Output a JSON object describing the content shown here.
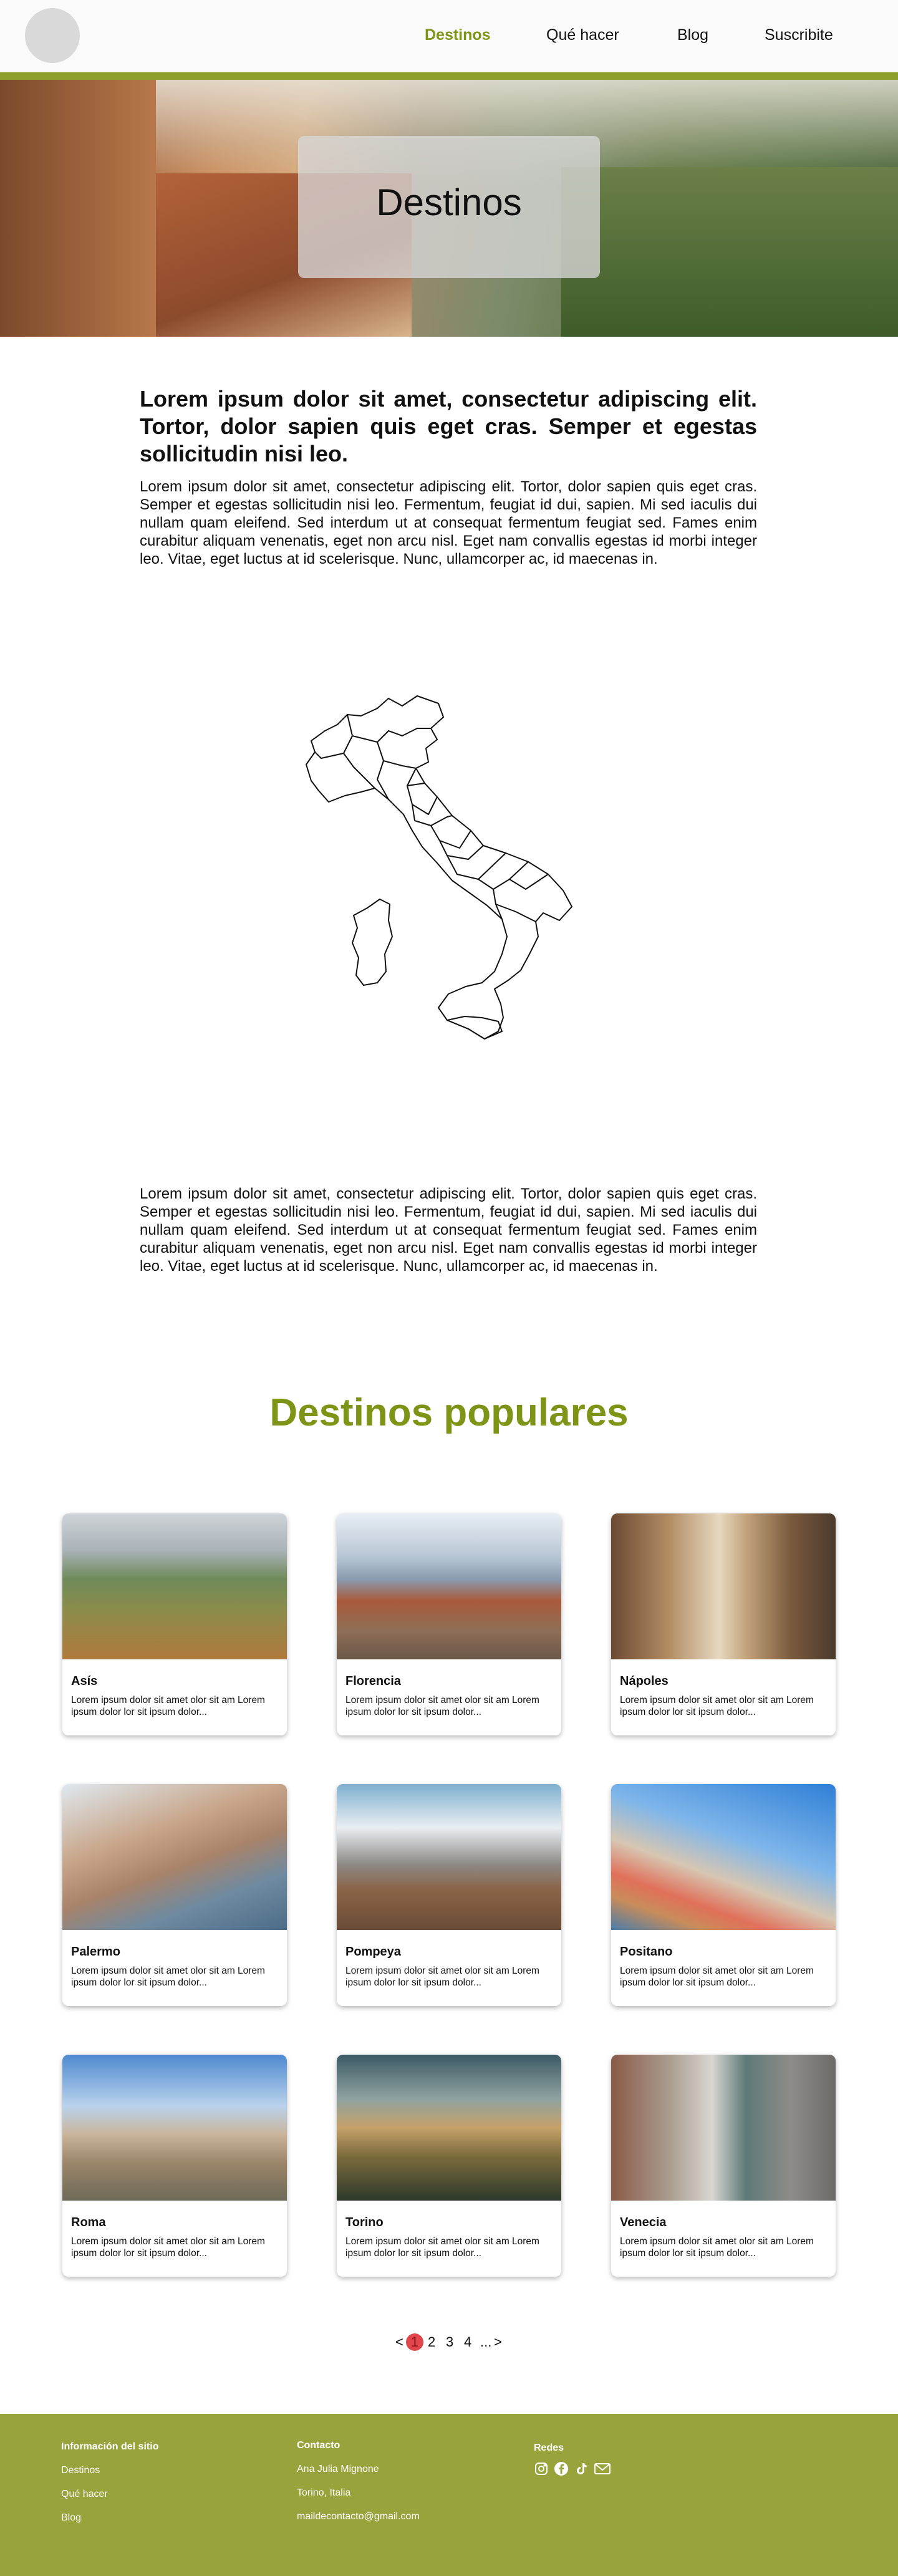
{
  "header": {
    "nav": [
      {
        "label": "Destinos",
        "active": true
      },
      {
        "label": "Qué hacer",
        "active": false
      },
      {
        "label": "Blog",
        "active": false
      },
      {
        "label": "Suscribite",
        "active": false
      }
    ]
  },
  "hero": {
    "title": "Destinos"
  },
  "intro": {
    "heading": "Lorem ipsum dolor sit amet, consectetur adipiscing elit. Tortor, dolor sapien quis eget cras. Semper et egestas sollicitudin nisi leo.",
    "text": "Lorem ipsum dolor sit amet, consectetur adipiscing elit. Tortor, dolor sapien quis eget cras. Semper et egestas sollicitudin nisi leo. Fermentum, feugiat id dui, sapien. Mi sed iaculis dui nullam quam eleifend. Sed interdum ut at consequat fermentum feugiat sed. Fames enim curabitur aliquam venenatis, eget non arcu nisl. Eget nam convallis egestas id morbi integer leo. Vitae, eget luctus at id scelerisque. Nunc, ullamcorper ac, id maecenas in."
  },
  "map": {
    "icon": "italy-map-icon"
  },
  "body_text": "Lorem ipsum dolor sit amet, consectetur adipiscing elit. Tortor, dolor sapien quis eget cras. Semper et egestas sollicitudin nisi leo. Fermentum, feugiat id dui, sapien. Mi sed iaculis dui nullam quam eleifend. Sed interdum ut at consequat fermentum feugiat sed. Fames enim curabitur aliquam venenatis, eget non arcu nisl. Eget nam convallis egestas id morbi integer leo. Vitae, eget luctus at id scelerisque. Nunc, ullamcorper ac, id maecenas in.",
  "popular": {
    "title": "Destinos populares",
    "cards": [
      {
        "name": "Asís",
        "desc": "Lorem ipsum dolor sit amet olor sit am Lorem ipsum dolor lor sit ipsum dolor..."
      },
      {
        "name": "Florencia",
        "desc": "Lorem ipsum dolor sit amet olor sit am Lorem ipsum dolor lor sit ipsum dolor..."
      },
      {
        "name": "Nápoles",
        "desc": "Lorem ipsum dolor sit amet olor sit am Lorem ipsum dolor lor sit ipsum dolor..."
      },
      {
        "name": "Palermo",
        "desc": "Lorem ipsum dolor sit amet olor sit am Lorem ipsum dolor lor sit ipsum dolor..."
      },
      {
        "name": "Pompeya",
        "desc": "Lorem ipsum dolor sit amet olor sit am Lorem ipsum dolor lor sit ipsum dolor..."
      },
      {
        "name": "Positano",
        "desc": "Lorem ipsum dolor sit amet olor sit am Lorem ipsum dolor lor sit ipsum dolor..."
      },
      {
        "name": "Roma",
        "desc": "Lorem ipsum dolor sit amet olor sit am Lorem ipsum dolor lor sit ipsum dolor..."
      },
      {
        "name": "Torino",
        "desc": "Lorem ipsum dolor sit amet olor sit am Lorem ipsum dolor lor sit ipsum dolor..."
      },
      {
        "name": "Venecia",
        "desc": "Lorem ipsum dolor sit amet olor sit am Lorem ipsum dolor lor sit ipsum dolor..."
      }
    ]
  },
  "pagination": {
    "prev": "<",
    "current": "1",
    "pages": [
      "2",
      "3",
      "4"
    ],
    "ellipsis": "...",
    "next": ">"
  },
  "footer": {
    "site_info_title": "Información del sitio",
    "site_links": [
      "Destinos",
      "Qué hacer",
      "Blog"
    ],
    "contact_title": "Contacto",
    "contact_items": [
      "Ana Julia Mignone",
      "Torino, Italia",
      "maildecontacto@gmail.com"
    ],
    "social_title": "Redes",
    "social_icons": [
      "instagram-icon",
      "facebook-icon",
      "tiktok-icon",
      "mail-icon"
    ]
  },
  "colors": {
    "accent": "#7e9416",
    "footer": "#98a33c",
    "accent_bar": "#8d9e2c",
    "page_active": "#e0474c"
  }
}
